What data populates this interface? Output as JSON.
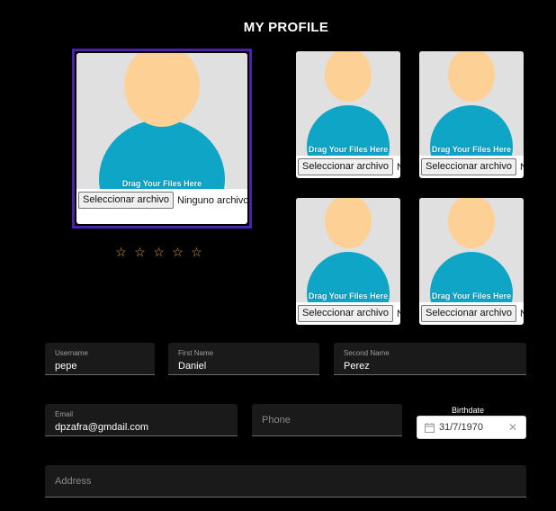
{
  "page_title": "MY PROFILE",
  "upload": {
    "drop_text": "Drag Your Files Here",
    "button_label": "Seleccionar archivo",
    "main_status": "Ninguno archivo s",
    "small_status": "Ni"
  },
  "rating": {
    "value": 0,
    "max": 5,
    "star_glyph": "☆"
  },
  "fields": {
    "username": {
      "label": "Username",
      "value": "pepe"
    },
    "first_name": {
      "label": "First Name",
      "value": "Daniel"
    },
    "second_name": {
      "label": "Second Name",
      "value": "Perez"
    },
    "email": {
      "label": "Email",
      "value": "dpzafra@gmdail.com"
    },
    "phone": {
      "placeholder": "Phone"
    },
    "birthdate": {
      "label": "Birthdate",
      "value": "31/7/1970",
      "clear_icon": "✕"
    },
    "address": {
      "placeholder": "Address"
    }
  },
  "colors": {
    "background": "#000000",
    "avatar_head": "#fdd096",
    "avatar_body": "#0ea5c6",
    "avatar_bg": "#e0e0e0",
    "selected_border": "#4a23a8",
    "star": "#e3a22a"
  },
  "icons": [
    "user-avatar-icon",
    "star-outline-icon",
    "calendar-icon",
    "clear-icon"
  ]
}
